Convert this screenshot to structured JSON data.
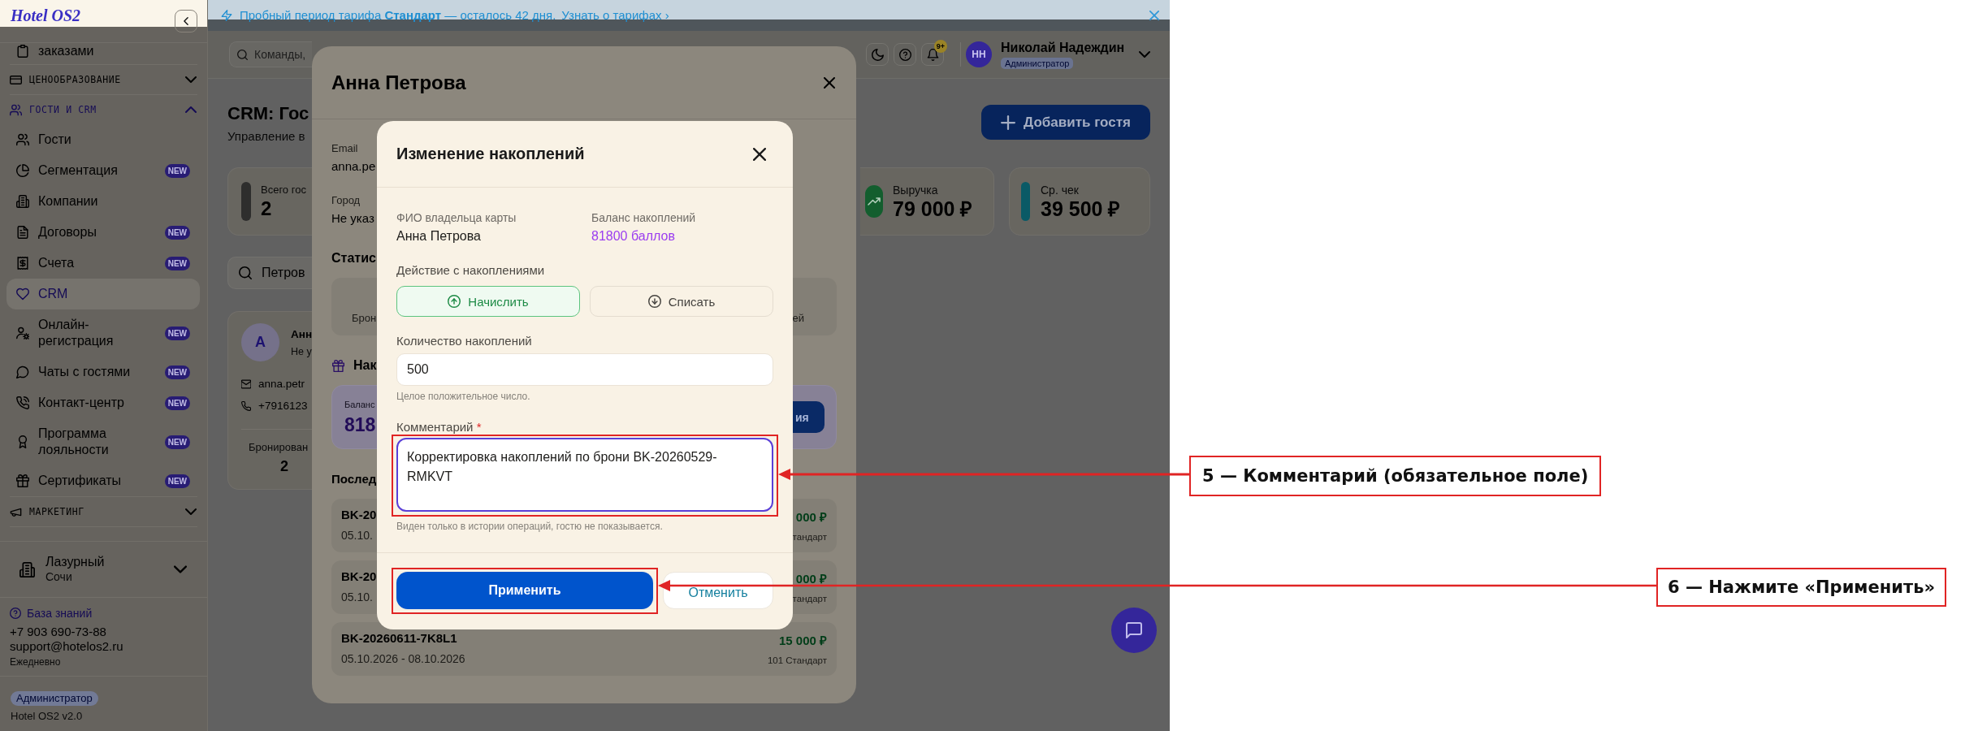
{
  "sidebar": {
    "logo": "Hotel OS2",
    "nav": [
      {
        "kind": "link",
        "label": "заказами",
        "selected": false
      },
      {
        "kind": "group",
        "label": "ЦЕНООБРАЗОВАНИЕ",
        "expanded": false
      },
      {
        "kind": "group",
        "label": "ГОСТИ И CRM",
        "expanded": true,
        "children": [
          {
            "label": "Гости",
            "selected": false
          },
          {
            "label": "Сегментация",
            "badge": "NEW",
            "selected": false
          },
          {
            "label": "Компании",
            "selected": false
          },
          {
            "label": "Договоры",
            "badge": "NEW",
            "selected": false
          },
          {
            "label": "Счета",
            "badge": "NEW",
            "selected": false
          },
          {
            "label": "CRM",
            "selected": true
          },
          {
            "label": "Онлайн-регистрация",
            "badge": "NEW",
            "selected": false
          },
          {
            "label": "Чаты с гостями",
            "badge": "NEW",
            "selected": false
          },
          {
            "label": "Контакт-центр",
            "badge": "NEW",
            "selected": false
          },
          {
            "label": "Программа лояльности",
            "badge": "NEW",
            "selected": false
          },
          {
            "label": "Сертификаты",
            "badge": "NEW",
            "selected": false
          }
        ]
      },
      {
        "kind": "group",
        "label": "МАРКЕТИНГ",
        "expanded": false
      }
    ],
    "hotel": {
      "name": "Лазурный",
      "city": "Сочи"
    },
    "support": {
      "link": "База знаний",
      "phone": "+7 903 690-73-88",
      "email": "support@hotelos2.ru",
      "hours": "Ежедневно"
    },
    "role": "Администратор",
    "version": "Hotel OS2 v2.0"
  },
  "banner": {
    "text": "Пробный период тарифа **Стандарт** — осталось 42 дня.",
    "link": "Узнать о тарифах ›"
  },
  "header": {
    "search": {
      "placeholder": "Команды,"
    },
    "notifications": "9+",
    "user": {
      "initials": "НН",
      "name": "Николай Надеждин",
      "role": "Администратор"
    }
  },
  "page": {
    "title": "CRM: Гос",
    "subtitle": "Управление в",
    "add_button": "Добавить гостя",
    "stats": [
      {
        "label": "Всего гос",
        "value": "2",
        "color": "#2e2e2d"
      },
      {
        "label": "Выручка",
        "value": "79 000 ₽",
        "color": "#135e2e"
      },
      {
        "label": "Ср. чек",
        "value": "39 500 ₽",
        "color": "#0a5a66"
      }
    ],
    "search": {
      "value": "Петров"
    },
    "guest": {
      "initial": "А",
      "name": "Анн",
      "status": "Не у",
      "email": "anna.petr",
      "phone": "+7916123",
      "stat_label": "Бронирован",
      "stat_value": "2"
    }
  },
  "guest_modal": {
    "title": "Анна Петрова",
    "fields": [
      {
        "label": "Email",
        "value": "anna.pe"
      },
      {
        "label": "Город",
        "value": "Не указ"
      }
    ],
    "stats_title": "Статис",
    "stats": [
      {
        "label": "Брон"
      },
      {
        "label": "ей"
      }
    ],
    "loyalty": {
      "title": "Нак",
      "balance_label": "Баланс",
      "balance": "818",
      "button": "ия"
    },
    "bookings_title": "Послед",
    "bookings": [
      {
        "code": "BK-20",
        "dates": "05.10.",
        "amount": "000 ₽",
        "tariff": "тандарт"
      },
      {
        "code": "BK-20",
        "dates": "05.10.",
        "amount": "000 ₽",
        "tariff": "тандарт"
      },
      {
        "code": "BK-20260611-7K8L1",
        "dates": "05.10.2026 - 08.10.2026",
        "amount": "15 000 ₽",
        "tariff": "101 Стандарт"
      }
    ]
  },
  "dialog": {
    "title": "Изменение накоплений",
    "holder": {
      "label": "ФИО владельца карты",
      "value": "Анна Петрова"
    },
    "balance": {
      "label": "Баланс накоплений",
      "value": "81800 баллов"
    },
    "action_label": "Действие с накоплениями",
    "actions": [
      {
        "label": "Начислить",
        "selected": true
      },
      {
        "label": "Списать",
        "selected": false
      }
    ],
    "amount": {
      "label": "Количество накоплений",
      "value": "500",
      "hint": "Целое положительное число."
    },
    "comment": {
      "label": "Комментарий",
      "required_mark": "*",
      "value": "Корректировка накоплений по брони BK-20260529-RMKVT",
      "hint": "Виден только в истории операций, гостю не показывается.",
      "callout": "5 — Комментарий (обязательное поле)"
    },
    "submit": {
      "label": "Применить",
      "callout": "6 — Нажмите «Применить»"
    },
    "cancel": "Отменить"
  }
}
